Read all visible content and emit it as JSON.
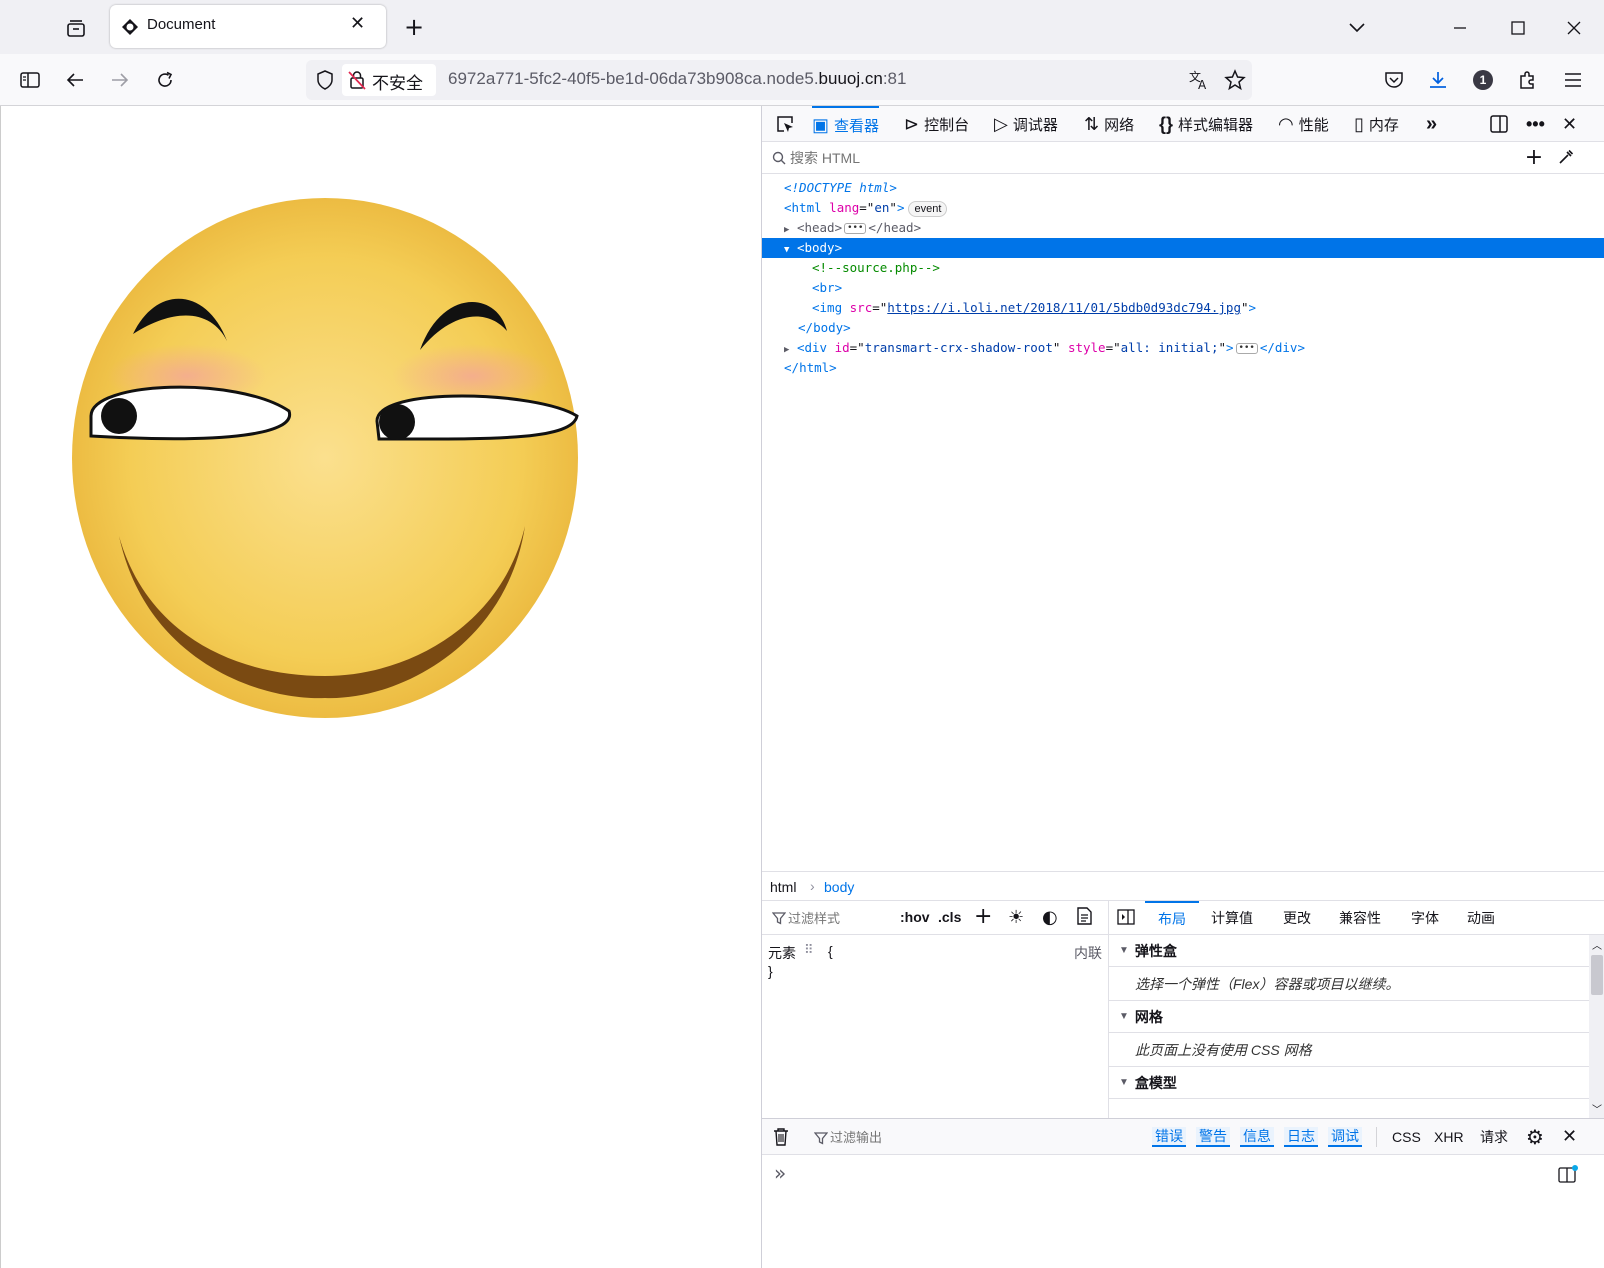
{
  "browser": {
    "tab_title": "Document",
    "url_security": "不安全",
    "url_host_prefix": "6972a771-5fc2-40f5-be1d-06da73b908ca.node5.",
    "url_domain": "buuoj.cn",
    "url_port": ":81",
    "notification_count": "1"
  },
  "devtools": {
    "tabs": [
      {
        "label": "查看器",
        "icon": "inspector-icon"
      },
      {
        "label": "控制台",
        "icon": "console-icon"
      },
      {
        "label": "调试器",
        "icon": "debugger-icon"
      },
      {
        "label": "网络",
        "icon": "network-icon"
      },
      {
        "label": "样式编辑器",
        "icon": "style-editor-icon"
      },
      {
        "label": "性能",
        "icon": "performance-icon"
      },
      {
        "label": "内存",
        "icon": "memory-icon"
      }
    ],
    "search_placeholder": "搜索 HTML",
    "tree": {
      "doctype": "<!DOCTYPE html>",
      "html_open_tag": "html",
      "html_attr_name": "lang",
      "html_attr_value": "en",
      "event_badge": "event",
      "head_tag": "head",
      "body_tag": "body",
      "comment": "<!--source.php-->",
      "br_tag": "br",
      "img_tag": "img",
      "img_attr": "src",
      "img_src": "https://i.loli.net/2018/11/01/5bdb0d93dc794.jpg",
      "div_tag": "div",
      "div_id_attr": "id",
      "div_id": "transmart-crx-shadow-root",
      "div_style_attr": "style",
      "div_style": "all: initial;"
    },
    "breadcrumb": [
      "html",
      "body"
    ],
    "rules": {
      "filter_placeholder": "过滤样式",
      "hov": ":hov",
      "cls": ".cls",
      "element_label": "元素",
      "open_brace": "{",
      "close_brace": "}",
      "inline_label": "内联"
    },
    "layout_tabs": [
      "布局",
      "计算值",
      "更改",
      "兼容性",
      "字体",
      "动画"
    ],
    "layout_sections": [
      {
        "title": "弹性盒",
        "message": "选择一个弹性（Flex）容器或项目以继续。"
      },
      {
        "title": "网格",
        "message": "此页面上没有使用 CSS 网格"
      },
      {
        "title": "盒模型"
      }
    ],
    "console": {
      "filter_placeholder": "过滤输出",
      "levels": [
        "错误",
        "警告",
        "信息",
        "日志",
        "调试"
      ],
      "types": [
        "CSS",
        "XHR",
        "请求"
      ],
      "prompt": "»"
    }
  },
  "colors": {
    "accent": "#0074e8",
    "face": "#f2c94c",
    "mouth": "#7a4a12"
  }
}
